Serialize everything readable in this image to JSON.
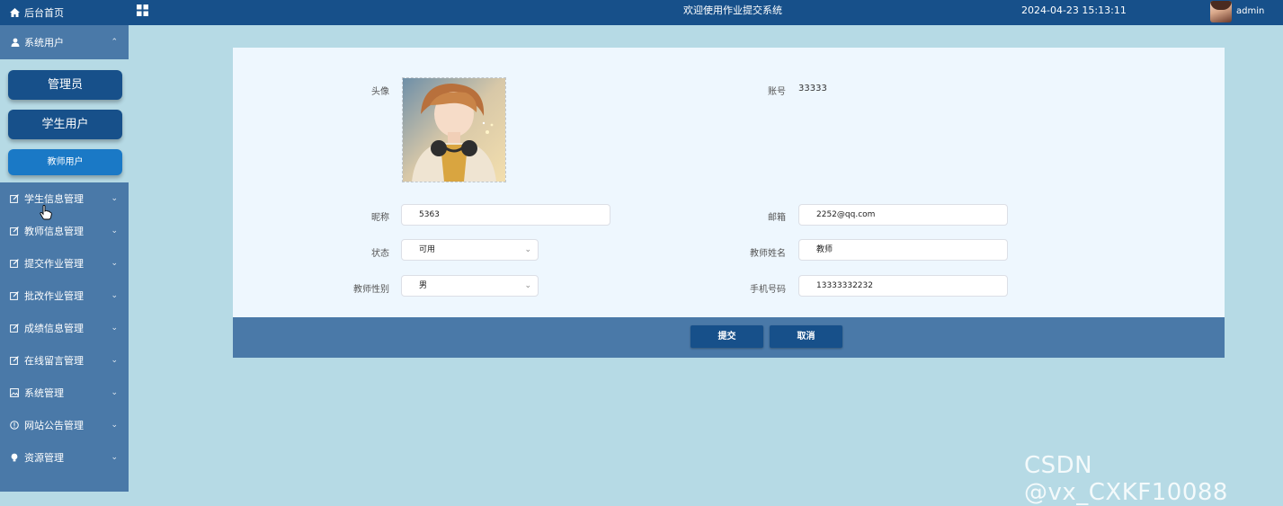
{
  "topbar": {
    "home_label": "后台首页",
    "title": "欢迎使用作业提交系统",
    "datetime": "2024-04-23 15:13:11",
    "username": "admin",
    "bg_color": "#17508a"
  },
  "sidebar": {
    "section_label": "系统用户",
    "section_icon": "user-icon",
    "sub_items": [
      "管理员",
      "学生用户",
      "教师用户"
    ],
    "menu": [
      {
        "label": "学生信息管理",
        "icon": "edit-icon"
      },
      {
        "label": "教师信息管理",
        "icon": "edit-icon"
      },
      {
        "label": "提交作业管理",
        "icon": "edit-icon"
      },
      {
        "label": "批改作业管理",
        "icon": "edit-icon"
      },
      {
        "label": "成绩信息管理",
        "icon": "edit-icon"
      },
      {
        "label": "在线留言管理",
        "icon": "edit-icon"
      },
      {
        "label": "系统管理",
        "icon": "picture-icon"
      },
      {
        "label": "网站公告管理",
        "icon": "info-circle-icon"
      },
      {
        "label": "资源管理",
        "icon": "bulb-icon"
      }
    ],
    "bg_color": "#4a79a8"
  },
  "form": {
    "avatar_label": "头像",
    "account_label": "账号",
    "account_value": "33333",
    "nickname_label": "昵称",
    "nickname_value": "5363",
    "email_label": "邮箱",
    "email_value": "2252@qq.com",
    "status_label": "状态",
    "status_value": "可用",
    "teacher_name_label": "教师姓名",
    "teacher_name_value": "教师",
    "gender_label": "教师性别",
    "gender_value": "男",
    "phone_label": "手机号码",
    "phone_value": "13333332232"
  },
  "actions": {
    "submit": "提交",
    "cancel": "取消"
  },
  "watermark": "CSDN @vx_CXKF10088"
}
